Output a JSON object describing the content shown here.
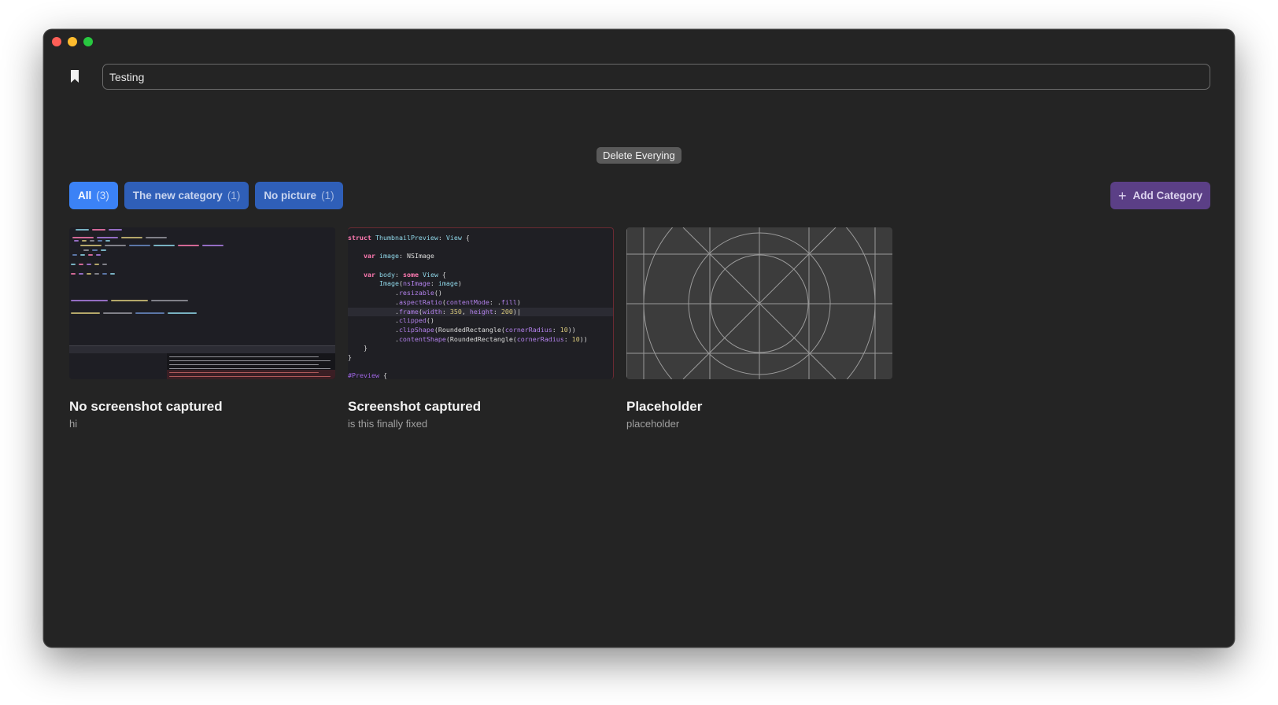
{
  "window": {
    "controls": [
      "close",
      "minimize",
      "zoom"
    ]
  },
  "search": {
    "value": "Testing",
    "placeholder": ""
  },
  "actions": {
    "delete_label": "Delete Everying",
    "add_category_label": "Add Category",
    "add_category_icon": "plus-icon"
  },
  "tabs": [
    {
      "label": "All",
      "count": "(3)",
      "active": true
    },
    {
      "label": "The new category",
      "count": "(1)",
      "active": false
    },
    {
      "label": "No picture",
      "count": "(1)",
      "active": false
    }
  ],
  "cards": [
    {
      "title": "No screenshot captured",
      "subtitle": "hi",
      "thumbnail": "code-editor-screenshot"
    },
    {
      "title": "Screenshot captured",
      "subtitle": "is this finally fixed",
      "thumbnail": "code-screenshot",
      "code_lines": [
        "struct ThumbnailPreview: View {",
        "",
        "    var image: NSImage",
        "",
        "    var body: some View {",
        "        Image(nsImage: image)",
        "            .resizable()",
        "            .aspectRatio(contentMode: .fill)",
        "            .frame(width: 350, height: 200)",
        "            .clipped()",
        "            .clipShape(RoundedRectangle(cornerRadius: 10))",
        "            .contentShape(RoundedRectangle(cornerRadius: 10))",
        "    }",
        "}",
        "",
        "#Preview {"
      ]
    },
    {
      "title": "Placeholder",
      "subtitle": "placeholder",
      "thumbnail": "placeholder-grid"
    }
  ],
  "colors": {
    "window_bg": "#242424",
    "tab_active": "#3b82f6",
    "tab_inactive": "#2f5fb8",
    "add_category_bg": "#5b3f86",
    "delete_bg": "#5a5a5a"
  }
}
